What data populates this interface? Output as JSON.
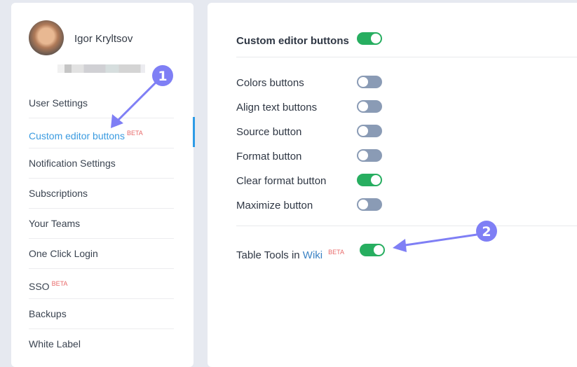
{
  "sidebar": {
    "user_name": "Igor Kryltsov",
    "items": [
      {
        "label": "User Settings",
        "beta": ""
      },
      {
        "label": "Custom editor buttons",
        "beta": "BETA",
        "active": true
      },
      {
        "label": "Notification Settings",
        "beta": ""
      },
      {
        "label": "Subscriptions",
        "beta": ""
      },
      {
        "label": "Your Teams",
        "beta": ""
      },
      {
        "label": "One Click Login",
        "beta": ""
      },
      {
        "label": "SSO",
        "beta": "BETA"
      },
      {
        "label": "Backups",
        "beta": ""
      },
      {
        "label": "White Label",
        "beta": ""
      }
    ]
  },
  "main": {
    "section_title": "Custom editor buttons",
    "section_enabled": true,
    "options": [
      {
        "label": "Colors buttons",
        "enabled": false
      },
      {
        "label": "Align text buttons",
        "enabled": false
      },
      {
        "label": "Source button",
        "enabled": false
      },
      {
        "label": "Format button",
        "enabled": false
      },
      {
        "label": "Clear format button",
        "enabled": true
      },
      {
        "label": "Maximize button",
        "enabled": false
      }
    ],
    "table_tools": {
      "prefix": "Table Tools in ",
      "link": "Wiki",
      "beta": "BETA",
      "enabled": true
    }
  },
  "annotations": {
    "badge_1": "1",
    "badge_2": "2",
    "color": "#7f7ff5"
  },
  "colors": {
    "toggle_on": "#27ae60",
    "toggle_off": "#8a9bb5",
    "active_link": "#3b9be0",
    "beta": "#e86a6a"
  }
}
